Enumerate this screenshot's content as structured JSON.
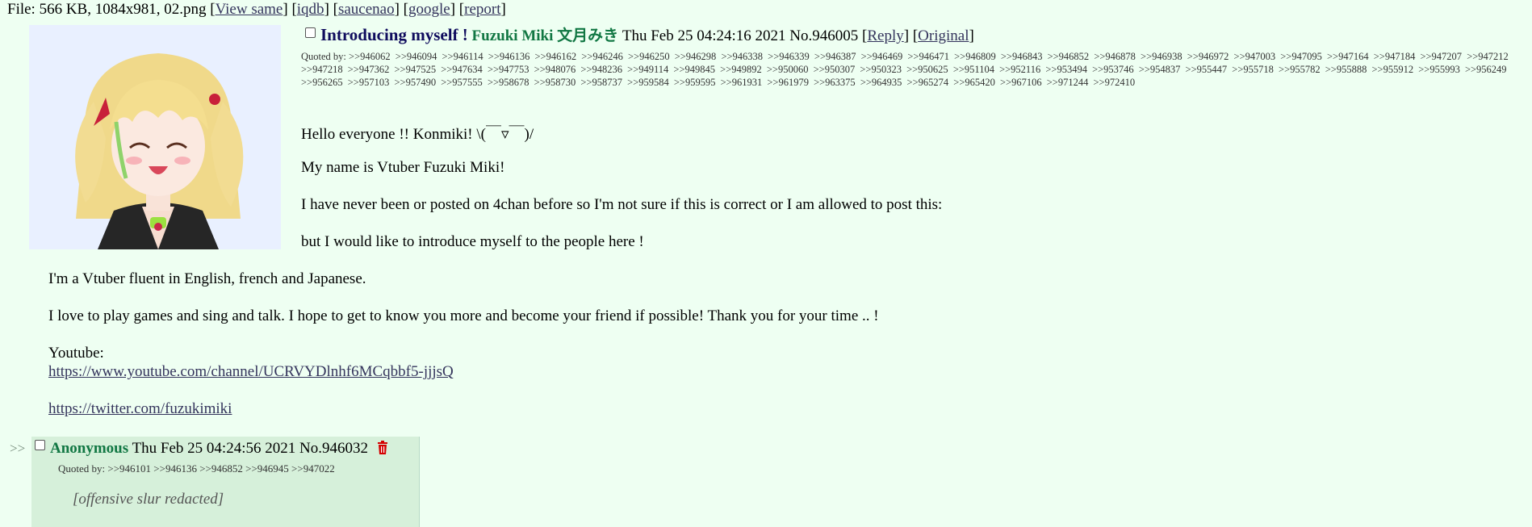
{
  "file_info": {
    "prefix": "File: 566 KB, 1084x981, 02.png ",
    "links": [
      "View same",
      "iqdb",
      "saucenao",
      "google",
      "report"
    ]
  },
  "op": {
    "subject": "Introducing myself !",
    "name": "Fuzuki Miki 文月みき",
    "datetime": "Thu Feb 25 04:24:16 2021",
    "post_no": "No.946005",
    "reply_label": "Reply",
    "original_label": "Original",
    "quoted_by_label": "Quoted by:",
    "quoted_by": [
      ">>946062",
      ">>946094",
      ">>946114",
      ">>946136",
      ">>946162",
      ">>946246",
      ">>946250",
      ">>946298",
      ">>946338",
      ">>946339",
      ">>946387",
      ">>946469",
      ">>946471",
      ">>946809",
      ">>946843",
      ">>946852",
      ">>946878",
      ">>946938",
      ">>946972",
      ">>947003",
      ">>947095",
      ">>947164",
      ">>947184",
      ">>947207",
      ">>947212",
      ">>947218",
      ">>947362",
      ">>947525",
      ">>947634",
      ">>947753",
      ">>948076",
      ">>948236",
      ">>949114",
      ">>949845",
      ">>949892",
      ">>950060",
      ">>950307",
      ">>950323",
      ">>950625",
      ">>951104",
      ">>952116",
      ">>953494",
      ">>953746",
      ">>954837",
      ">>955447",
      ">>955718",
      ">>955782",
      ">>955888",
      ">>955912",
      ">>955993",
      ">>956249",
      ">>956265",
      ">>957103",
      ">>957490",
      ">>957555",
      ">>958678",
      ">>958730",
      ">>958737",
      ">>959584",
      ">>959595",
      ">>961931",
      ">>961979",
      ">>963375",
      ">>964935",
      ">>965274",
      ">>965420",
      ">>967106",
      ">>971244",
      ">>972410"
    ],
    "lines": [
      "Hello everyone !! Konmiki!  \\(￣▿￣)/",
      "My name is Vtuber Fuzuki Miki!",
      "I have never been or posted on 4chan before so I'm not sure if this is correct or I am allowed to post this:",
      "but I would like to introduce myself to the people here !",
      "I'm a Vtuber fluent in English, french and Japanese.",
      "I love to play games and sing and talk. I hope to get to know you more and become your friend if possible! Thank you for your time .. !",
      "Youtube:"
    ],
    "youtube_url": "https://www.youtube.com/channel/UCRVYDlnhf6MCqbbf5-jjjsQ",
    "twitter_url": "https://twitter.com/fuzukimiki"
  },
  "reply": {
    "arrows": ">>",
    "name": "Anonymous",
    "datetime": "Thu Feb 25 04:24:56 2021",
    "post_no": "No.946032",
    "quoted_by_label": "Quoted by:",
    "quoted_by": ">>946101 >>946136 >>946852 >>946945 >>947022",
    "text": "[offensive slur redacted]"
  },
  "colors": {
    "background": "#eefff2",
    "subject": "#0f0c5d",
    "name": "#117743",
    "link": "#34345c",
    "reply_bg": "#d6f0da",
    "trash": "#d40000"
  }
}
